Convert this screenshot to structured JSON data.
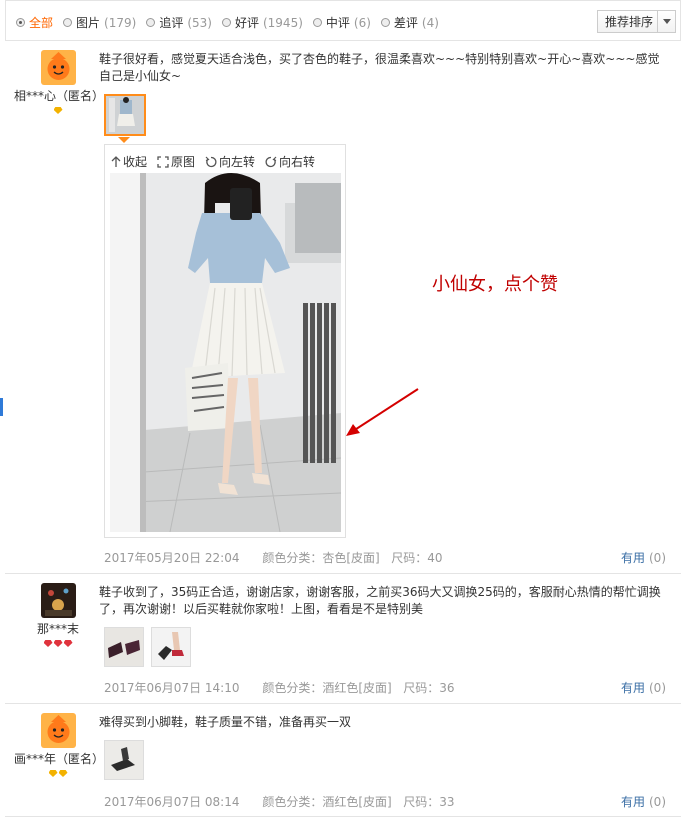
{
  "filters": [
    {
      "label": "全部",
      "count": "",
      "active": true
    },
    {
      "label": "图片",
      "count": "(179)",
      "active": false
    },
    {
      "label": "追评",
      "count": "(53)",
      "active": false
    },
    {
      "label": "好评",
      "count": "(1945)",
      "active": false
    },
    {
      "label": "中评",
      "count": "(6)",
      "active": false
    },
    {
      "label": "差评",
      "count": "(4)",
      "active": false
    }
  ],
  "sort": {
    "label": "推荐排序"
  },
  "viewer_tools": {
    "collapse": "收起",
    "original": "原图",
    "rotate_left": "向左转",
    "rotate_right": "向右转"
  },
  "annotation": "小仙女，点个赞",
  "reviews": [
    {
      "user": "相***心（匿名）",
      "text": "鞋子很好看，感觉夏天适合浅色，买了杏色的鞋子，很温柔喜欢~~~特别特别喜欢~开心~喜欢~~~感觉自己是小仙女~",
      "date": "2017年05月20日 22:04",
      "color": "颜色分类：杏色[皮面]",
      "size": "尺码：40",
      "useful_label": "有用",
      "useful_count": "(0)"
    },
    {
      "user": "那***末",
      "text": "鞋子收到了，35码正合适，谢谢店家，谢谢客服，之前买36码大又调换25码的，客服耐心热情的帮忙调换了，再次谢谢！以后买鞋就你家啦！上图，看看是不是特别美",
      "date": "2017年06月07日 14:10",
      "color": "颜色分类：酒红色[皮面]",
      "size": "尺码：36",
      "useful_label": "有用",
      "useful_count": "(0)"
    },
    {
      "user": "画***年（匿名）",
      "text": "难得买到小脚鞋，鞋子质量不错，准备再买一双",
      "date": "2017年06月07日 08:14",
      "color": "颜色分类：酒红色[皮面]",
      "size": "尺码：33",
      "useful_label": "有用",
      "useful_count": "(0)"
    }
  ],
  "colors": {
    "accent": "#ff6600",
    "link": "#3a6ea5",
    "annotation": "#c00000",
    "muted": "#999999"
  }
}
